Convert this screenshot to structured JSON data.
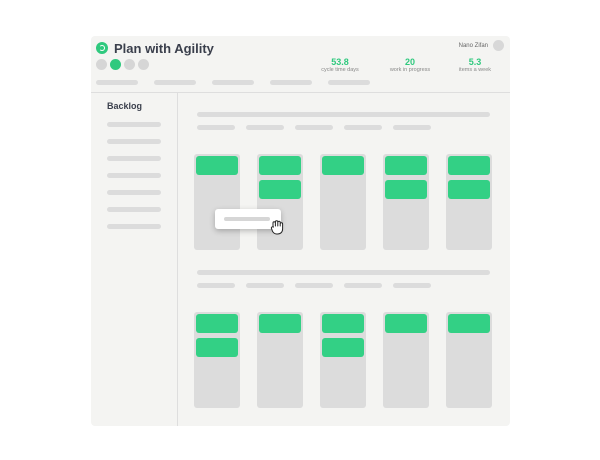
{
  "app": {
    "title": "Plan with Agility"
  },
  "user": {
    "name": "Nano Zifan"
  },
  "colors": {
    "accent": "#2fc97e",
    "card": "#33d085",
    "placeholder": "#dcdcdc"
  },
  "metrics": [
    {
      "value": "53.8",
      "label": "cycle time days"
    },
    {
      "value": "20",
      "label": "work in progress"
    },
    {
      "value": "5.3",
      "label": "items a week"
    }
  ],
  "sidebar": {
    "title": "Backlog"
  },
  "icons": {
    "logo": "agility-logo-icon",
    "drag": "grab-hand-icon"
  }
}
